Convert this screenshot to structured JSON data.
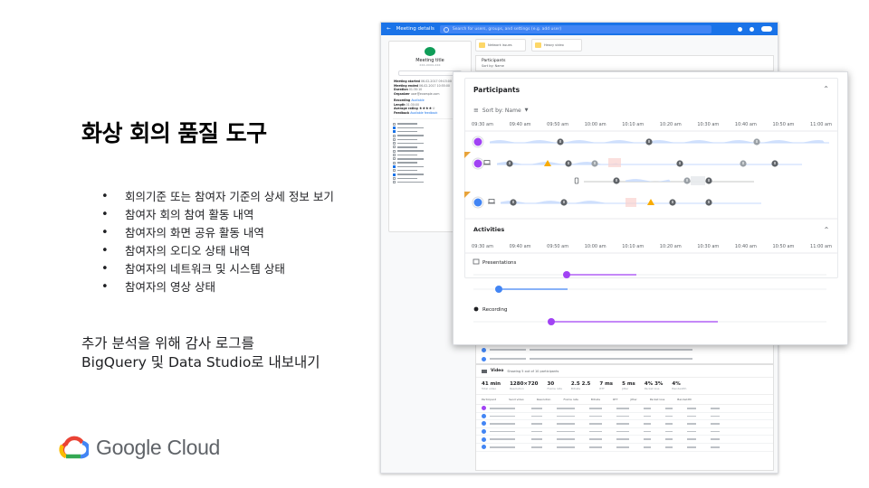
{
  "slide": {
    "title": "화상 회의 품질 도구",
    "bullets": [
      "회의기준 또는 참여자 기준의 상세 정보 보기",
      "참여자 회의 참여 활동 내역",
      "참여자의 화면 공유 활동 내역",
      "참여자의 오디오 상태 내역",
      "참여자의 네트워크 및 시스템 상태",
      "참여자의 영상 상태"
    ],
    "export_text": "추가 분석을 위해 감사 로그를\nBigQuery 및 Data Studio로 내보내기",
    "logo_text": "Google Cloud"
  },
  "app": {
    "title": "Meeting details",
    "search_placeholder": "Search for users, groups, and settings (e.g. add user)",
    "meeting_title": "Meeting title",
    "meeting_sub": "xxx-xxxx-xxx",
    "kpis": [
      "Network issues",
      "Heavy video"
    ],
    "back_participants": "Participants",
    "back_sort": "Sort by: Name",
    "details": [
      [
        "Meeting started",
        "06-02-2017 09:15:00"
      ],
      [
        "Meeting ended",
        "06-02-2017 10:55:00"
      ],
      [
        "Duration",
        "01:30:10"
      ],
      [
        "Organizer",
        "user@example.com"
      ],
      [
        "Recording",
        "Available"
      ],
      [
        "Length",
        "01:30:00"
      ],
      [
        "Average rating",
        "★★★★☆"
      ],
      [
        "Feedback",
        "Available feedback"
      ]
    ],
    "video_title": "Video",
    "video_sub": "Showing 5 out of 10 participants",
    "video_stats": [
      [
        "41 min",
        "Total video"
      ],
      [
        "1280×720",
        "Resolution"
      ],
      [
        "30",
        "Frame rate"
      ],
      [
        "2.5 2.5",
        "Bitrate"
      ],
      [
        "7 ms",
        "RTT"
      ],
      [
        "5 ms",
        "Jitter"
      ],
      [
        "4% 3%",
        "Packet loss"
      ],
      [
        "4%",
        "Bandwidth"
      ]
    ]
  },
  "front": {
    "participants_title": "Participants",
    "sort_label": "Sort by: Name",
    "activities_title": "Activities",
    "presentations_label": "Presentations",
    "recording_label": "Recording",
    "times": [
      "09:30 am",
      "09:40 am",
      "09:50 am",
      "10:00 am",
      "10:10 am",
      "10:20 am",
      "10:30 am",
      "10:40 am",
      "10:50 am",
      "11:00 am"
    ]
  },
  "colors": {
    "app_bar": "#1a73e8",
    "purple": "#a142f4",
    "blue": "#4285f4",
    "warning": "#f9ab00",
    "track": "#c6dafc"
  }
}
